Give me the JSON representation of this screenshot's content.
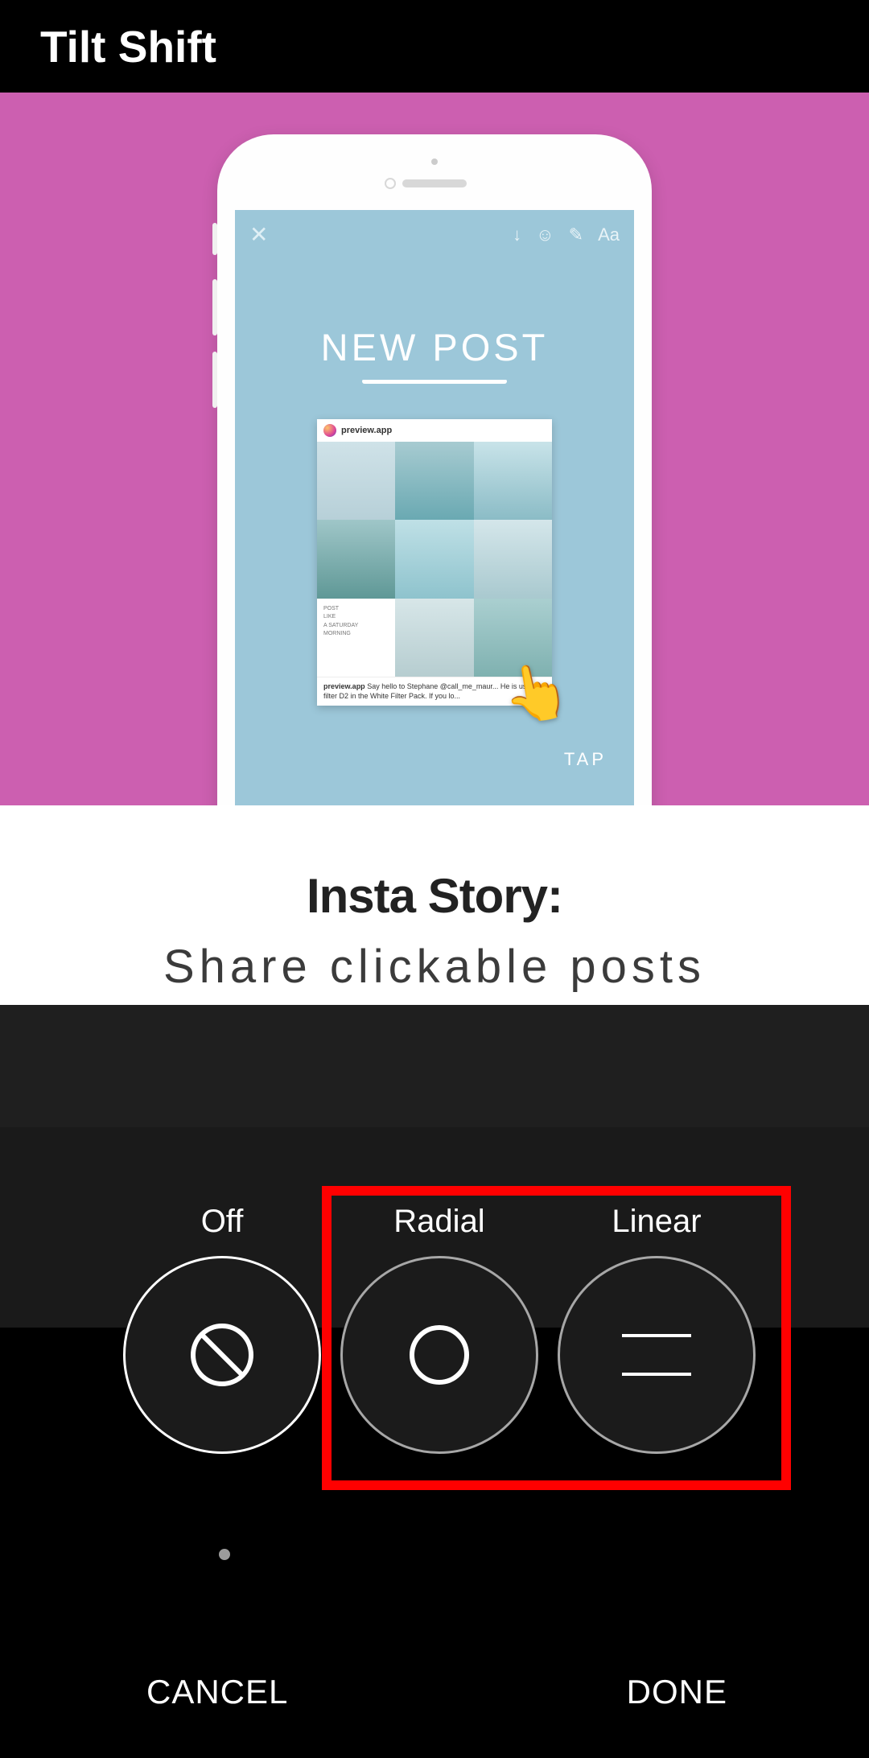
{
  "header": {
    "title": "Tilt Shift"
  },
  "preview": {
    "phone": {
      "story": {
        "top_close": "✕",
        "icons": {
          "download": "↓",
          "sticker": "☺",
          "pen": "✎",
          "text": "Aa"
        },
        "headline": "NEW POST",
        "card": {
          "username": "preview.app",
          "mini_text": {
            "line1": "POST",
            "line2": "LIKE",
            "line3": "A SATURDAY",
            "line4": "MORNING"
          },
          "caption_user": "preview.app",
          "caption_text": " Say hello to Stephane @call_me_maur... He is using filter D2 in the White Filter Pack. If you lo..."
        },
        "tap_label": "TAP"
      }
    },
    "lower": {
      "title": "Insta Story:",
      "subtitle": "Share clickable posts"
    }
  },
  "options": [
    {
      "key": "off",
      "label": "Off",
      "icon": "off-icon"
    },
    {
      "key": "radial",
      "label": "Radial",
      "icon": "radial-icon"
    },
    {
      "key": "linear",
      "label": "Linear",
      "icon": "linear-icon"
    }
  ],
  "highlighted_options": [
    "radial",
    "linear"
  ],
  "footer": {
    "cancel": "CANCEL",
    "done": "DONE"
  },
  "colors": {
    "accent_pink": "#cc5fb0",
    "panel_dark": "#1b1b1b",
    "highlight": "#ff0000"
  }
}
